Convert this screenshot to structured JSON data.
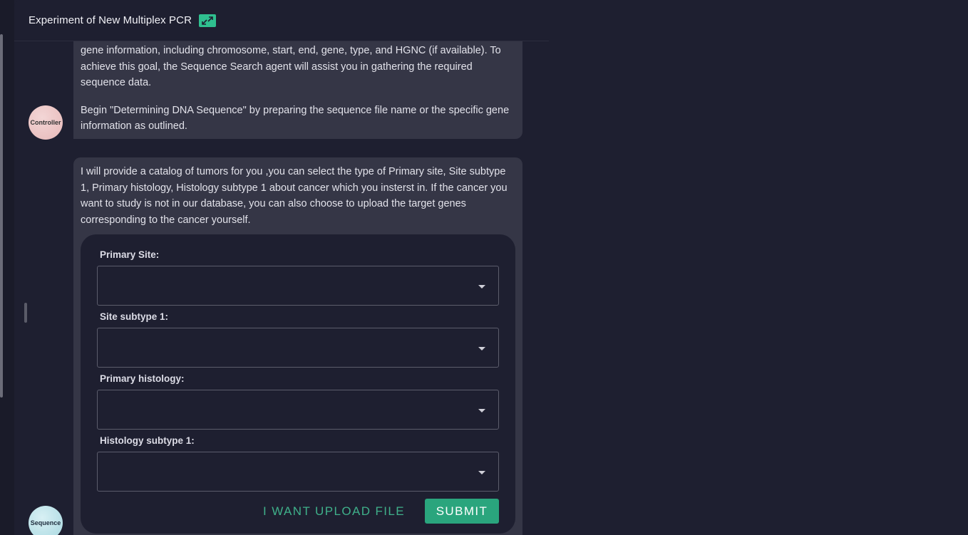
{
  "panel": {
    "title": "Experiment of New Multiplex PCR",
    "expand_icon": "expand-arrows-icon"
  },
  "messages": [
    {
      "sender": "Controller",
      "avatar_label": "Controller",
      "paragraphs": [
        "gene information, including chromosome, start, end, gene, type, and HGNC (if available). To achieve this goal, the Sequence Search agent will assist you in gathering the required sequence data.",
        "Begin \"Determining DNA Sequence\" by preparing the sequence file name or the specific gene information as outlined."
      ]
    },
    {
      "sender": "Sequence",
      "avatar_label": "Sequence",
      "text": "I will provide a catalog of tumors for you ,you can select the type of  Primary site, Site subtype 1, Primary histology, Histology subtype 1 about cancer which you insterst in.  If the cancer you want to study is not in our database, you can also choose to upload the target genes corresponding to the cancer yourself."
    }
  ],
  "form": {
    "fields": [
      {
        "label": "Primary Site:",
        "value": ""
      },
      {
        "label": "Site subtype 1:",
        "value": ""
      },
      {
        "label": "Primary histology:",
        "value": ""
      },
      {
        "label": "Histology subtype 1:",
        "value": ""
      }
    ],
    "upload_label": "I WANT UPLOAD FILE",
    "submit_label": "SUBMIT"
  },
  "colors": {
    "background": "#1e1f30",
    "bubble": "#353646",
    "accent": "#2aa57d",
    "accent_text": "#3fb08a"
  }
}
